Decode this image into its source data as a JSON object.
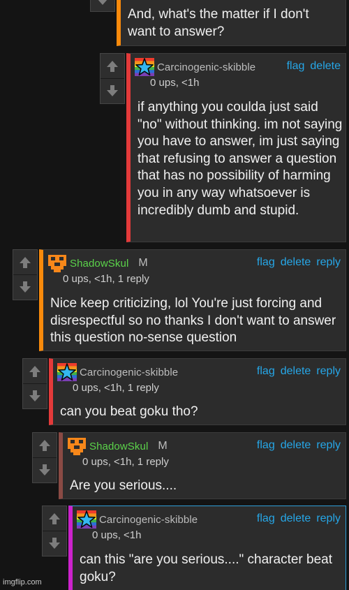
{
  "vote_icons": {
    "up": "arrow-up-icon",
    "down": "arrow-down-icon"
  },
  "colors": {
    "action_link": "#26a7e8",
    "shadowskul_name": "#5bd34a",
    "mod_badge": "#bdbdbd"
  },
  "comments": [
    {
      "accent": "#f98a0b",
      "body": "And, what's the matter if I don't want to answer?"
    },
    {
      "accent": "#e33a3a",
      "username": "Carcinogenic-skibble",
      "meta": "0 ups, <1h",
      "actions": {
        "flag": "flag",
        "delete": "delete"
      },
      "body": "if anything you coulda just said \"no\" without thinking. im not saying you have to answer, im just saying that refusing to answer a question that has no possibility of harming you in any way whatsoever is incredibly dumb and stupid."
    },
    {
      "accent": "#f98a0b",
      "username": "ShadowSkul",
      "badge": "M",
      "meta": "0 ups, <1h, 1 reply",
      "actions": {
        "flag": "flag",
        "delete": "delete",
        "reply": "reply"
      },
      "body": "Nice keep criticizing, lol You're just forcing and disrespectful so no thanks I don't want to answer this question no-sense question"
    },
    {
      "accent": "#e33a3a",
      "username": "Carcinogenic-skibble",
      "meta": "0 ups, <1h, 1 reply",
      "actions": {
        "flag": "flag",
        "delete": "delete",
        "reply": "reply"
      },
      "body": "can you beat goku tho?"
    },
    {
      "accent": "#8a4a44",
      "username": "ShadowSkul",
      "badge": "M",
      "meta": "0 ups, <1h, 1 reply",
      "actions": {
        "flag": "flag",
        "delete": "delete",
        "reply": "reply"
      },
      "body": "Are you serious...."
    },
    {
      "accent": "#cc22cc",
      "username": "Carcinogenic-skibble",
      "meta": "0 ups, <1h",
      "actions": {
        "flag": "flag",
        "delete": "delete",
        "reply": "reply"
      },
      "body": "can this \"are you serious....\" character beat goku?"
    }
  ],
  "watermark": "imgflip.com"
}
